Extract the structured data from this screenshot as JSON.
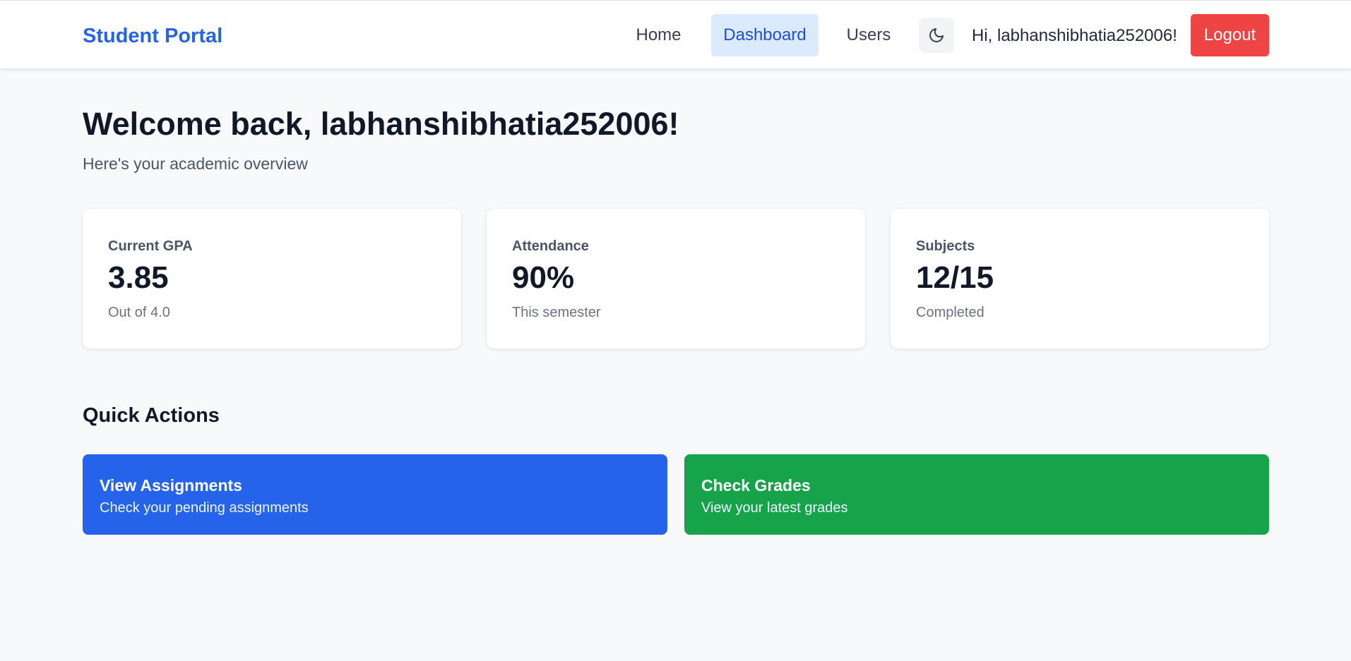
{
  "nav": {
    "brand": "Student Portal",
    "links": [
      {
        "label": "Home",
        "active": false
      },
      {
        "label": "Dashboard",
        "active": true
      },
      {
        "label": "Users",
        "active": false
      }
    ],
    "theme_toggle_icon": "moon-icon",
    "greeting": "Hi, labhanshibhatia252006!",
    "logout_label": "Logout"
  },
  "welcome": {
    "title": "Welcome back, labhanshibhatia252006!",
    "subtitle": "Here's your academic overview"
  },
  "stats": [
    {
      "label": "Current GPA",
      "value": "3.85",
      "note": "Out of 4.0"
    },
    {
      "label": "Attendance",
      "value": "90%",
      "note": "This semester"
    },
    {
      "label": "Subjects",
      "value": "12/15",
      "note": "Completed"
    }
  ],
  "quick_actions": {
    "title": "Quick Actions",
    "items": [
      {
        "title": "View Assignments",
        "description": "Check your pending assignments"
      },
      {
        "title": "Check Grades",
        "description": "View your latest grades"
      }
    ]
  },
  "colors": {
    "brand": "#2563eb",
    "active_tab_bg": "#dbeafe",
    "logout": "#ef4444",
    "assignments_card": "#2563eb",
    "grades_card": "#16a34a",
    "page_bg": "#f8f9fb"
  }
}
